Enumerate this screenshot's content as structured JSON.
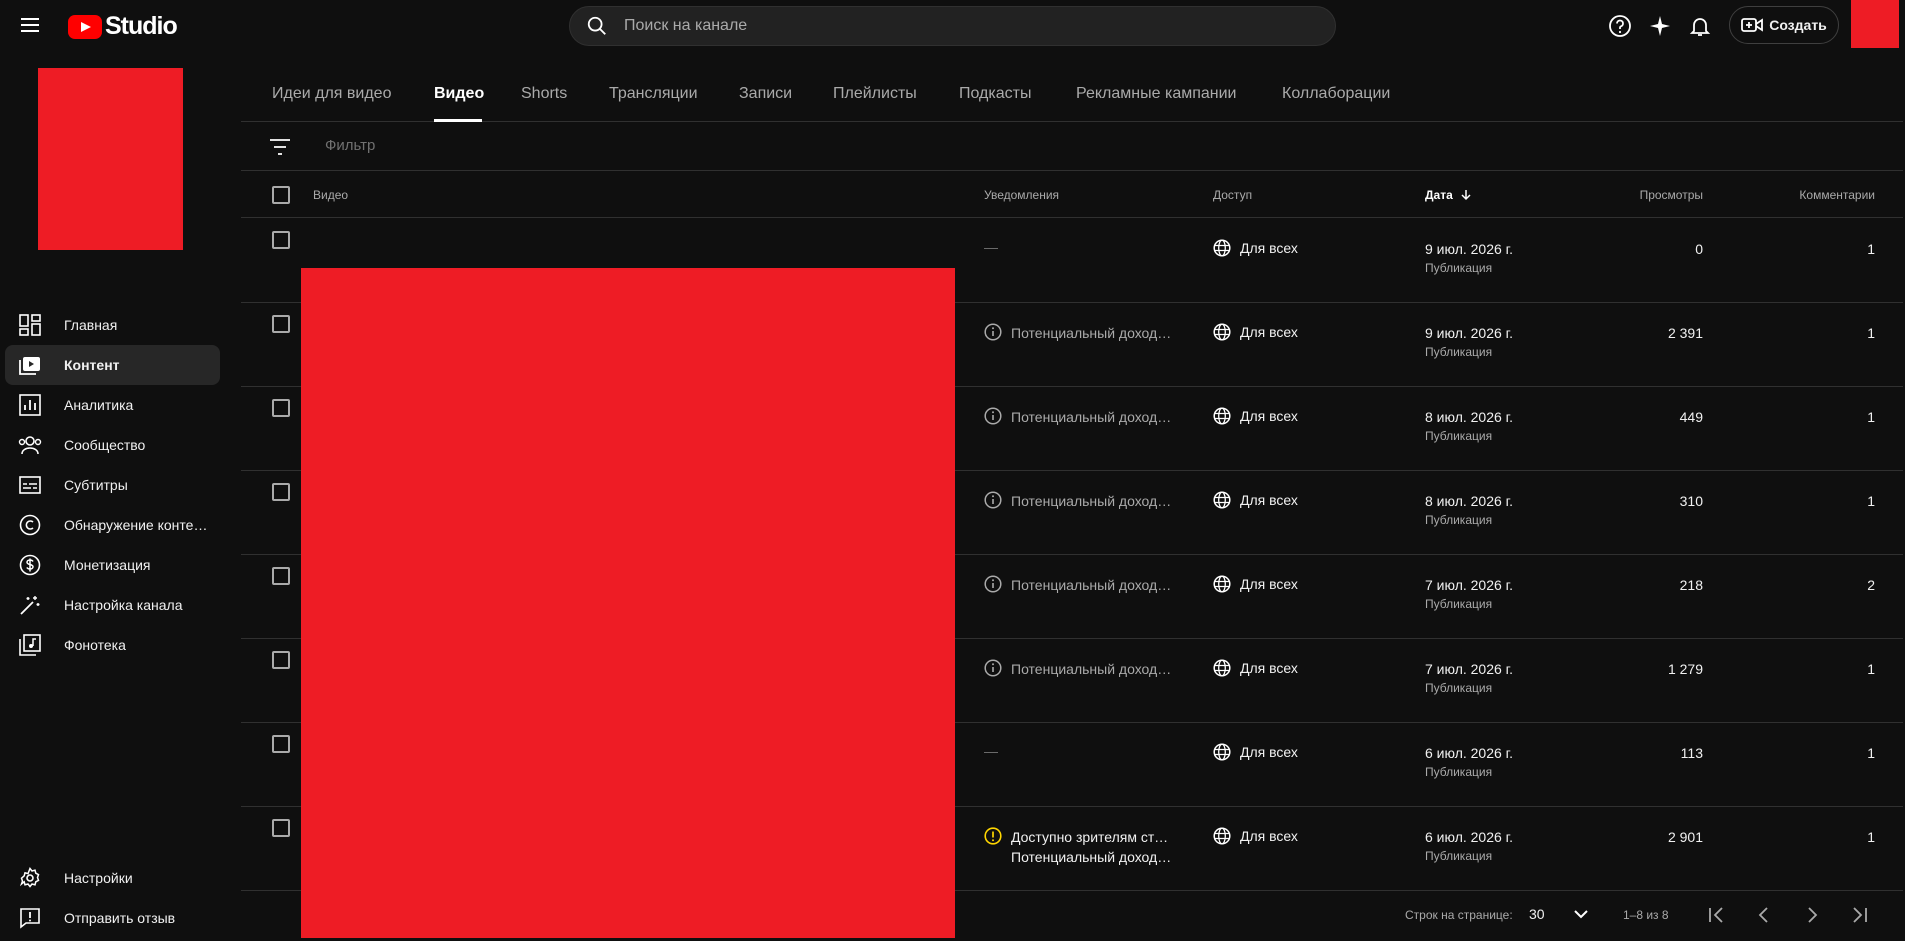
{
  "app": {
    "logo_text": "Studio"
  },
  "header": {
    "search_placeholder": "Поиск на канале",
    "create_label": "Создать"
  },
  "sidebar": {
    "items": [
      {
        "label": "Главная",
        "icon": "dashboard-icon"
      },
      {
        "label": "Контент",
        "icon": "content-icon",
        "active": true
      },
      {
        "label": "Аналитика",
        "icon": "analytics-icon"
      },
      {
        "label": "Сообщество",
        "icon": "community-icon"
      },
      {
        "label": "Субтитры",
        "icon": "subtitles-icon"
      },
      {
        "label": "Обнаружение контен…",
        "icon": "copyright-icon"
      },
      {
        "label": "Монетизация",
        "icon": "monetization-icon"
      },
      {
        "label": "Настройка канала",
        "icon": "customization-icon"
      },
      {
        "label": "Фонотека",
        "icon": "audio-library-icon"
      }
    ],
    "bottom": [
      {
        "label": "Настройки",
        "icon": "settings-icon"
      },
      {
        "label": "Отправить отзыв",
        "icon": "feedback-icon"
      }
    ]
  },
  "tabs": [
    "Идеи для видео",
    "Видео",
    "Shorts",
    "Трансляции",
    "Записи",
    "Плейлисты",
    "Подкасты",
    "Рекламные кампании",
    "Коллаборации"
  ],
  "active_tab": "Видео",
  "filter": {
    "placeholder": "Фильтр"
  },
  "table": {
    "columns": {
      "video": "Видео",
      "notifications": "Уведомления",
      "access": "Доступ",
      "date": "Дата",
      "views": "Просмотры",
      "comments": "Комментарии"
    },
    "rows": [
      {
        "notification": "—",
        "notif_type": "none",
        "access": "Для всех",
        "date": "9 июл. 2026 г.",
        "date_sub": "Публикация",
        "views": "0",
        "comments": "1"
      },
      {
        "notification": "Потенциальный доход …",
        "notif_type": "info",
        "access": "Для всех",
        "date": "9 июл. 2026 г.",
        "date_sub": "Публикация",
        "views": "2 391",
        "comments": "1"
      },
      {
        "notification": "Потенциальный доход …",
        "notif_type": "info",
        "access": "Для всех",
        "date": "8 июл. 2026 г.",
        "date_sub": "Публикация",
        "views": "449",
        "comments": "1"
      },
      {
        "notification": "Потенциальный доход …",
        "notif_type": "info",
        "access": "Для всех",
        "date": "8 июл. 2026 г.",
        "date_sub": "Публикация",
        "views": "310",
        "comments": "1"
      },
      {
        "notification": "Потенциальный доход …",
        "notif_type": "info",
        "access": "Для всех",
        "date": "7 июл. 2026 г.",
        "date_sub": "Публикация",
        "views": "218",
        "comments": "2"
      },
      {
        "notification": "Потенциальный доход …",
        "notif_type": "info",
        "access": "Для всех",
        "date": "7 июл. 2026 г.",
        "date_sub": "Публикация",
        "views": "1 279",
        "comments": "1"
      },
      {
        "notification": "—",
        "notif_type": "none",
        "access": "Для всех",
        "date": "6 июл. 2026 г.",
        "date_sub": "Публикация",
        "views": "113",
        "comments": "1"
      },
      {
        "notification": "Доступно зрителям ста…",
        "notification_line2": "Потенциальный доход …",
        "notif_type": "warning",
        "access": "Для всех",
        "date": "6 июл. 2026 г.",
        "date_sub": "Публикация",
        "views": "2 901",
        "comments": "1"
      }
    ]
  },
  "pagination": {
    "rows_label": "Строк на странице:",
    "rows_value": "30",
    "range": "1–8 из 8"
  },
  "colors": {
    "accent": "#ee1c25",
    "warning": "#ffd600",
    "background": "#0f0f0f"
  }
}
